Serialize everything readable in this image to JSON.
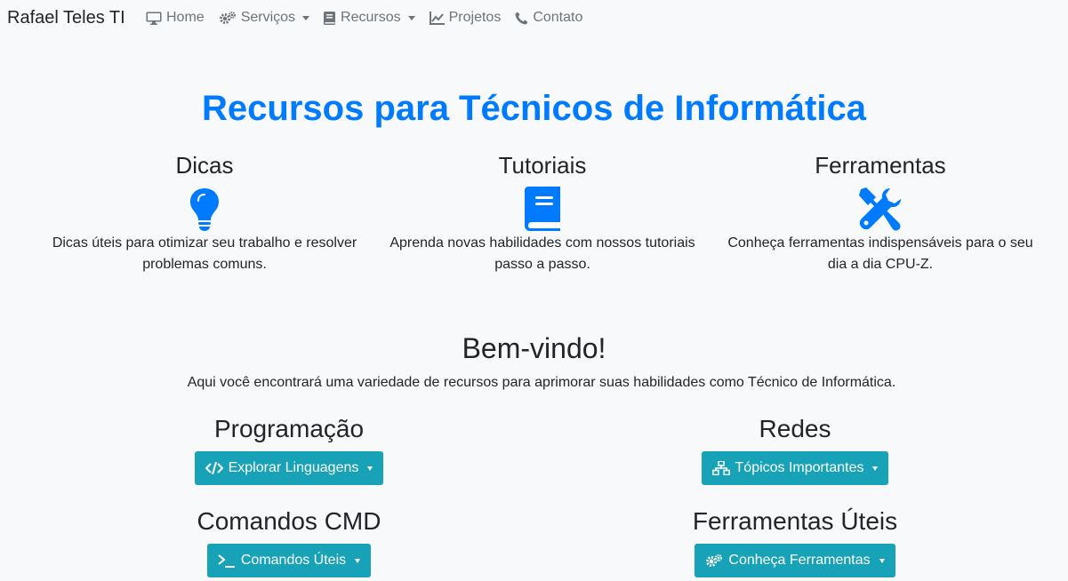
{
  "brand": "Rafael Teles TI",
  "nav": {
    "home": "Home",
    "servicos": "Serviços",
    "recursos": "Recursos",
    "projetos": "Projetos",
    "contato": "Contato"
  },
  "hero": {
    "title": "Recursos para Técnicos de Informática"
  },
  "features": [
    {
      "title": "Dicas",
      "icon": "lightbulb-icon",
      "text": "Dicas úteis para otimizar seu trabalho e resolver problemas comuns."
    },
    {
      "title": "Tutoriais",
      "icon": "book-icon",
      "text": "Aprenda novas habilidades com nossos tutoriais passo a passo."
    },
    {
      "title": "Ferramentas",
      "icon": "tools-icon",
      "text": "Conheça ferramentas indispensáveis para o seu dia a dia CPU-Z."
    }
  ],
  "welcome": {
    "title": "Bem-vindo!",
    "text": "Aqui você encontrará uma variedade de recursos para aprimorar suas habilidades como Técnico de Informática."
  },
  "sections": {
    "programacao": {
      "title": "Programação",
      "button": "Explorar Linguagens"
    },
    "redes": {
      "title": "Redes",
      "button": "Tópicos Importantes"
    },
    "cmd": {
      "title": "Comandos CMD",
      "button": "Comandos Úteis"
    },
    "ferramentas": {
      "title": "Ferramentas Úteis",
      "button": "Conheça Ferramentas"
    }
  },
  "colors": {
    "accent": "#007bff",
    "button": "#17a2b8",
    "background": "#f8f9fa",
    "nav_text": "#6c757d"
  }
}
